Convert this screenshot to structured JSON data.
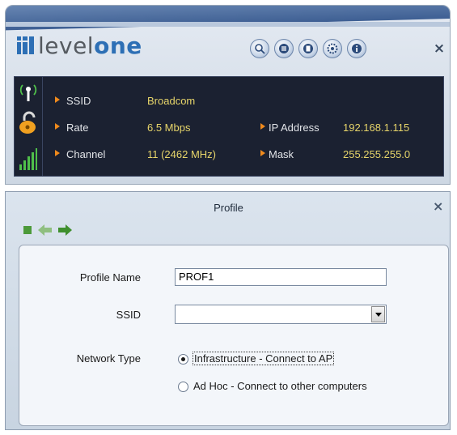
{
  "app": {
    "logo_prefix": "level",
    "logo_suffix": "one",
    "toolbar_icons": [
      "search-icon",
      "list-icon",
      "page-icon",
      "gear-icon",
      "info-icon"
    ],
    "close_label": "×"
  },
  "status": {
    "ssid_label": "SSID",
    "ssid_value": "Broadcom",
    "rate_label": "Rate",
    "rate_value": "6.5 Mbps",
    "channel_label": "Channel",
    "channel_value": "11 (2462 MHz)",
    "ip_label": "IP Address",
    "ip_value": "192.168.1.115",
    "mask_label": "Mask",
    "mask_value": "255.255.255.0",
    "icons": [
      "antenna-icon",
      "unlock-icon",
      "signal-strength-icon"
    ],
    "bullet_color": "#f08a1c",
    "value_color": "#e7d56a"
  },
  "profile": {
    "title": "Profile",
    "close_label": "×",
    "nav_icons": [
      "stop-icon",
      "back-arrow-icon",
      "forward-arrow-icon"
    ],
    "profile_name_label": "Profile Name",
    "profile_name_value": "PROF1",
    "ssid_label": "SSID",
    "ssid_value": "",
    "network_type_label": "Network Type",
    "network_options": [
      {
        "label": "Infrastructure - Connect to AP",
        "selected": true
      },
      {
        "label": "Ad Hoc - Connect to other computers",
        "selected": false
      }
    ]
  }
}
